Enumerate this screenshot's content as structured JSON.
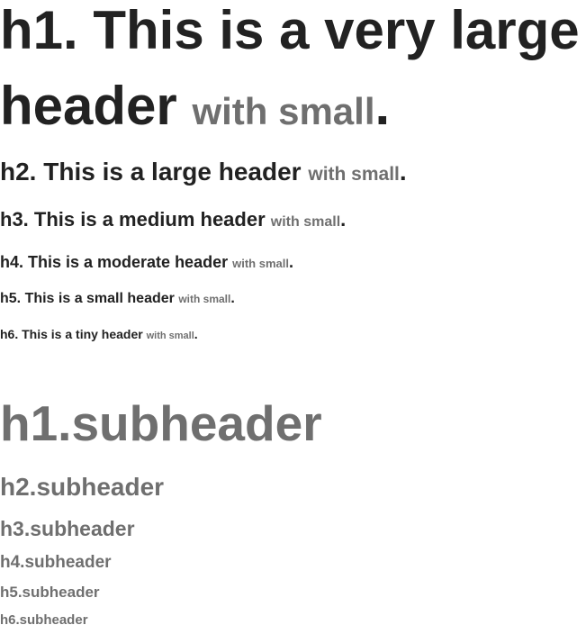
{
  "headers": [
    {
      "level": "h1",
      "text": "h1. This is a very large header",
      "small": "with small",
      "end": "."
    },
    {
      "level": "h2",
      "text": "h2. This is a large header",
      "small": "with small",
      "end": "."
    },
    {
      "level": "h3",
      "text": "h3. This is a medium header",
      "small": "with small",
      "end": "."
    },
    {
      "level": "h4",
      "text": "h4. This is a moderate header",
      "small": "with small",
      "end": "."
    },
    {
      "level": "h5",
      "text": "h5. This is a small header",
      "small": "with small",
      "end": "."
    },
    {
      "level": "h6",
      "text": "h6. This is a tiny header",
      "small": "with small",
      "end": "."
    }
  ],
  "subheaders": [
    "h1.subheader",
    "h2.subheader",
    "h3.subheader",
    "h4.subheader",
    "h5.subheader",
    "h6.subheader"
  ]
}
